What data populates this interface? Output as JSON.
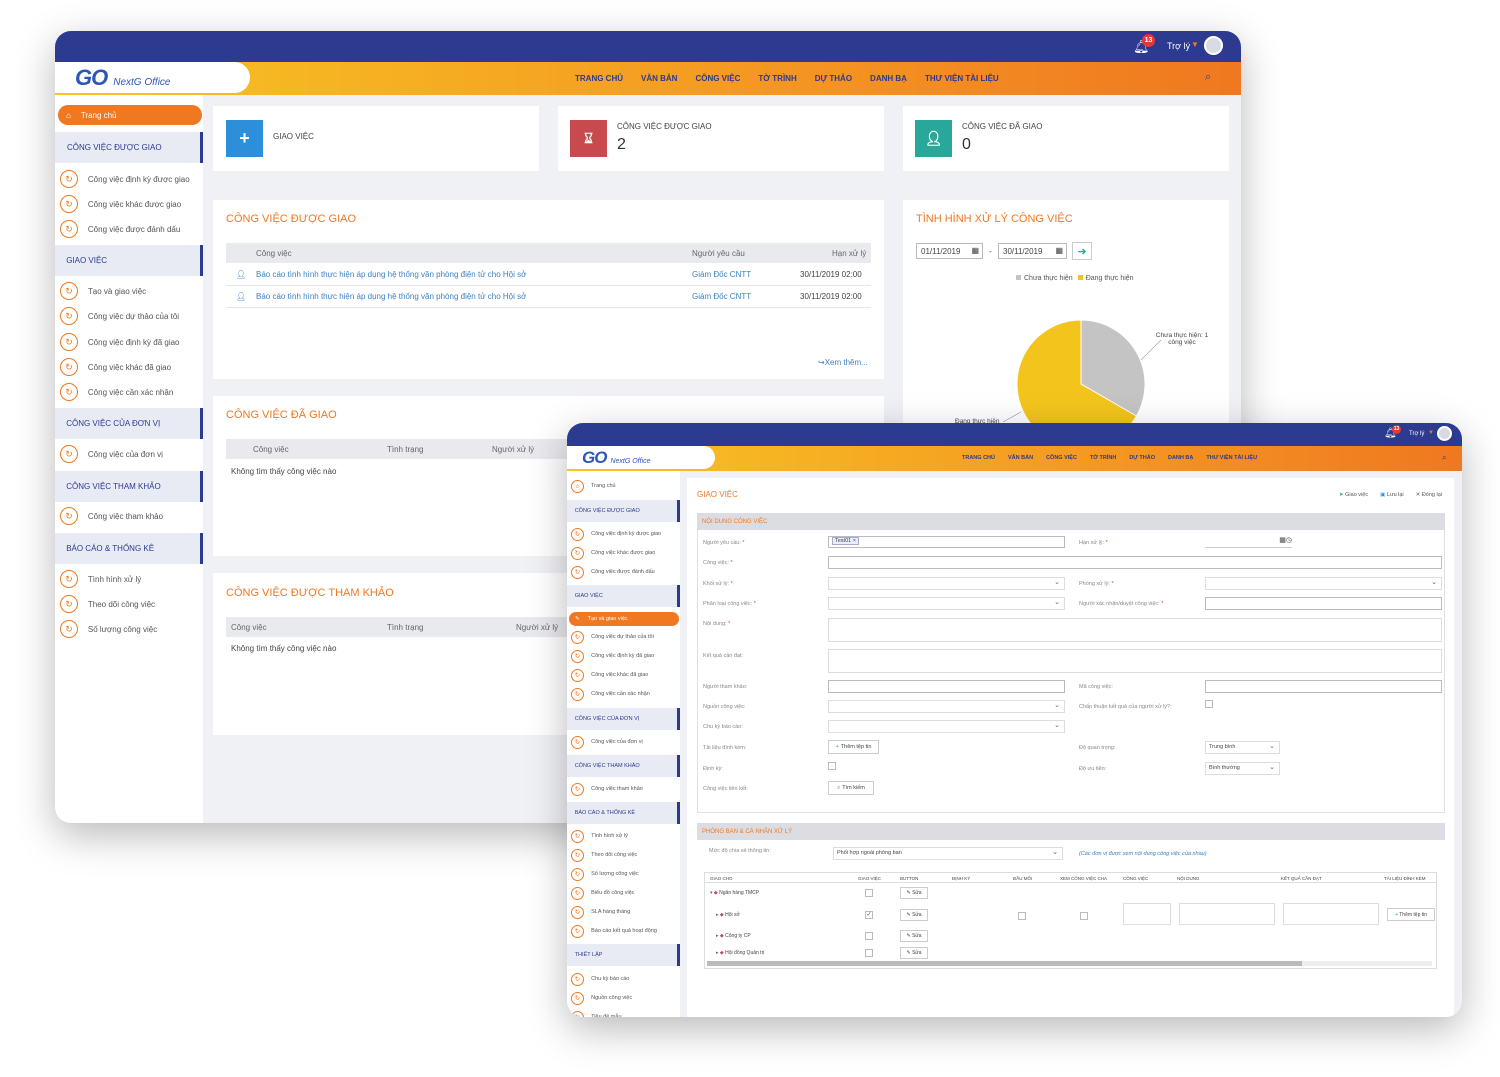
{
  "app": {
    "name": "NextG Office",
    "logo": "GO",
    "notify_count": "13",
    "user": "Trợ lý"
  },
  "menu": [
    "TRANG CHỦ",
    "VĂN BẢN",
    "CÔNG VIỆC",
    "TỜ TRÌNH",
    "DỰ THẢO",
    "DANH BẠ",
    "THƯ VIỆN TÀI LIỆU"
  ],
  "sidebar": {
    "home": "Trang chủ",
    "g1": "CÔNG VIỆC ĐƯỢC GIAO",
    "g1_items": [
      "Công việc định kỳ được giao",
      "Công việc khác được giao",
      "Công việc được đánh dấu"
    ],
    "g2": "GIAO VIỆC",
    "g2_items": [
      "Tạo và giao việc",
      "Công việc dự thảo của tôi",
      "Công việc định kỳ đã giao",
      "Công việc khác đã giao",
      "Công việc cần xác nhận"
    ],
    "g3": "CÔNG VIỆC CỦA ĐƠN VỊ",
    "g3_items": [
      "Công việc của đơn vị"
    ],
    "g4": "CÔNG VIỆC THAM KHẢO",
    "g4_items": [
      "Công việc tham khảo"
    ],
    "g5": "BÁO CÁO & THỐNG KÊ",
    "g5_items": [
      "Tình hình xử lý",
      "Theo dõi công việc",
      "Số lượng công việc"
    ],
    "g5_items_w2": [
      "Tình hình xử lý",
      "Theo dõi công việc",
      "Số lượng công việc",
      "Biểu đồ công việc",
      "SLA hàng tháng",
      "Báo cáo kết quả hoạt động"
    ],
    "g6": "THIẾT LẬP",
    "g6_items": [
      "Chu kỳ báo cáo",
      "Nguồn công việc",
      "Tiêu đề mẫu"
    ]
  },
  "kpi": {
    "assign_label": "GIAO VIỆC",
    "received_label": "CÔNG VIỆC ĐƯỢC GIAO",
    "received_value": "2",
    "given_label": "CÔNG VIỆC ĐÃ GIAO",
    "given_value": "0"
  },
  "received": {
    "title": "CÔNG VIỆC ĐƯỢC GIAO",
    "cols": [
      "Công việc",
      "Người yêu cầu",
      "Hạn xử lý"
    ],
    "rows": [
      {
        "task": "Báo cáo tình hình thực hiện áp dụng hệ thống văn phòng điện tử cho Hội sở",
        "requester": "Giám Đốc CNTT",
        "due": "30/11/2019 02:00"
      },
      {
        "task": "Báo cáo tình hình thực hiện áp dụng hệ thống văn phòng điện tử cho Hội sở",
        "requester": "Giám Đốc CNTT",
        "due": "30/11/2019 02:00"
      }
    ],
    "more": "Xem thêm..."
  },
  "given": {
    "title": "CÔNG VIỆC ĐÃ GIAO",
    "cols": [
      "Công việc",
      "Tình trạng",
      "Người xử lý"
    ],
    "empty": "Không tìm thấy công việc nào"
  },
  "ref": {
    "title": "CÔNG VIỆC ĐƯỢC THAM KHẢO",
    "cols": [
      "Công việc",
      "Tình trạng",
      "Người xử lý"
    ],
    "empty": "Không tìm thấy công việc nào"
  },
  "status": {
    "title": "TÌNH HÌNH XỬ LÝ CÔNG VIỆC",
    "from": "01/11/2019",
    "to": "30/11/2019",
    "sep": "-",
    "legend": [
      "Chưa thực hiện",
      "Đang thực hiện"
    ],
    "callout": "Chưa thực hiện: 1 công việc",
    "callout2": "Đang thực hiện"
  },
  "chart_data": {
    "type": "pie",
    "categories": [
      "Chưa thực hiện",
      "Đang thực hiện"
    ],
    "values": [
      1,
      2
    ],
    "colors": [
      "#c4c4c4",
      "#f3c51c"
    ]
  },
  "form": {
    "title": "GIAO VIỆC",
    "actions": [
      "Giao việc",
      "Lưu lại",
      "Đóng lại"
    ],
    "sec1": "NỘI DUNG CÔNG VIỆC",
    "sec2": "PHÒNG BAN & CÁ NHÂN XỬ LÝ",
    "requester_label": "Người yêu cầu:",
    "requester_value": "Test01",
    "deadline_label": "Hạn xử lý:",
    "task_label": "Công việc:",
    "block_label": "Khối xử lý:",
    "room_label": "Phòng xử lý:",
    "type_label": "Phân loại công việc:",
    "approver_label": "Người xác nhận/duyệt công việc:",
    "content_label": "Nội dung:",
    "result_label": "Kết quả cần đạt:",
    "ref_label": "Người tham khảo:",
    "code_label": "Mã công việc:",
    "source_label": "Nguồn công việc:",
    "approve_label": "Chấp thuận kết quả của người xử lý?:",
    "cycle_label": "Chu kỳ báo cáo:",
    "attach_label": "Tài liệu đính kèm:",
    "attach_btn": "Thêm tệp tin",
    "importance_label": "Độ quan trọng:",
    "importance_value": "Trung bình",
    "periodic_label": "Định kỳ:",
    "priority_label": "Độ ưu tiên:",
    "priority_value": "Bình thường",
    "linked_label": "Công việc liên kết:",
    "search_btn": "Tìm kiếm",
    "share_label": "Mức độ chia sẻ thông tin:",
    "share_value": "Phối hợp ngoài phòng ban",
    "share_note": "(Các đơn vị được xem nội dung công việc của nhau)",
    "grid_cols": [
      "GIAO CHO",
      "GIAO VIỆC",
      "BUTTON",
      "ĐỊNH KỲ",
      "ĐẦU MỐI",
      "XEM CÔNG VIỆC CHA",
      "CÔNG VIỆC",
      "NỘI DUNG",
      "KẾT QUẢ CẦN ĐẠT",
      "TÀI LIỆU ĐÍNH KÈM"
    ],
    "grid_rows": [
      "Ngân hàng TMCP",
      "Hội sở",
      "Công ty CP",
      "Hội đồng Quản trị"
    ],
    "edit": "Sửa",
    "add_file": "Thêm tệp tin"
  }
}
